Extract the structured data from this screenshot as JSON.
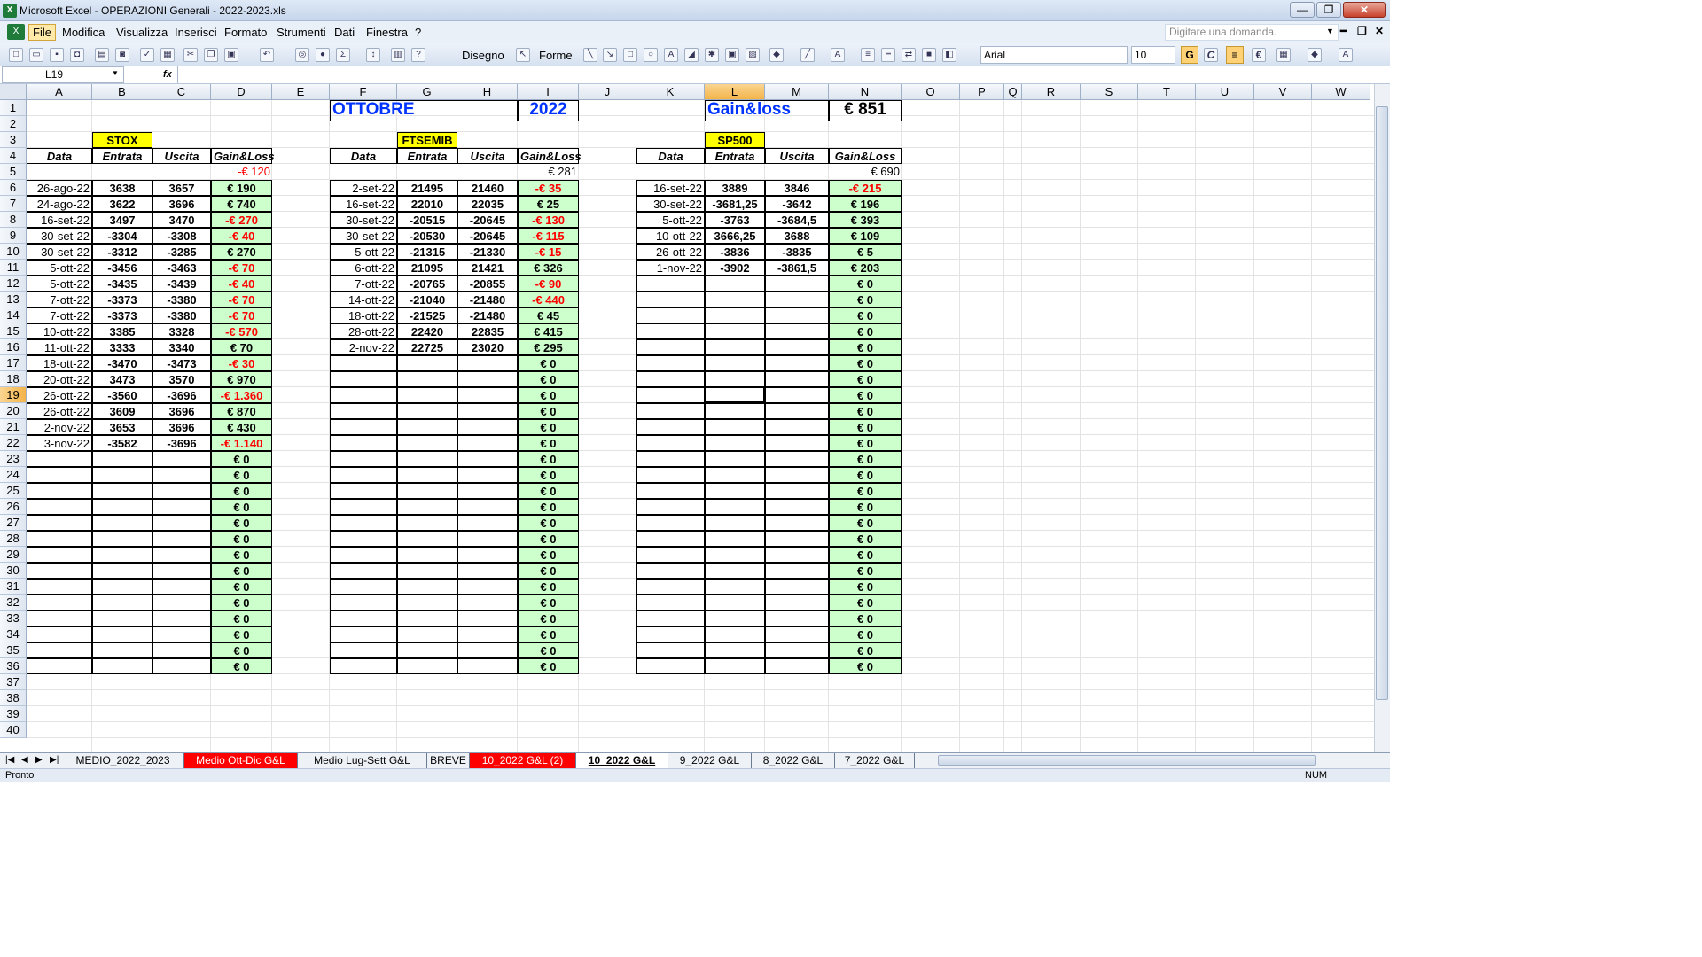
{
  "window": {
    "title": "Microsoft Excel - OPERAZIONI Generali - 2022-2023.xls",
    "min": "—",
    "max": "❐",
    "close": "✕"
  },
  "menu": {
    "items": [
      "File",
      "Modifica",
      "Visualizza",
      "Inserisci",
      "Formato",
      "Strumenti",
      "Dati",
      "Finestra",
      "?"
    ],
    "help_placeholder": "Digitare una domanda.",
    "mdi_min": "━",
    "mdi_restore": "❐",
    "mdi_close": "✕"
  },
  "toolbar": {
    "draw_label": "Disegno",
    "shapes_label": "Forme",
    "font": "Arial",
    "font_size": "10",
    "bold": "G",
    "italic": "C",
    "euro": "€"
  },
  "formula": {
    "cell_ref": "L19",
    "fx": "fx",
    "content": ""
  },
  "columns": [
    "A",
    "B",
    "C",
    "D",
    "E",
    "F",
    "G",
    "H",
    "I",
    "J",
    "K",
    "L",
    "M",
    "N",
    "O",
    "P",
    "Q",
    "R",
    "S",
    "T",
    "U",
    "V",
    "W"
  ],
  "rows": [
    "1",
    "2",
    "3",
    "4",
    "5",
    "6",
    "7",
    "8",
    "9",
    "10",
    "11",
    "12",
    "13",
    "14",
    "15",
    "16",
    "17",
    "18",
    "19",
    "20",
    "21",
    "22",
    "23",
    "24",
    "25",
    "26",
    "27",
    "28",
    "29",
    "30",
    "31",
    "32",
    "33",
    "34",
    "35",
    "36",
    "37",
    "38",
    "39",
    "40"
  ],
  "selected_col": "L",
  "selected_row": "19",
  "header": {
    "month": "OTTOBRE",
    "year": "2022",
    "gl_label": "Gain&loss",
    "gl_total": "€ 851"
  },
  "headings": {
    "date": "Data",
    "entry": "Entrata",
    "exit": "Uscita",
    "gl": "Gain&Loss"
  },
  "stox": {
    "label": "STOX",
    "subtotal": "-€ 120",
    "rows": [
      {
        "d": "26-ago-22",
        "e": "3638",
        "u": "3657",
        "g": "€ 190"
      },
      {
        "d": "24-ago-22",
        "e": "3622",
        "u": "3696",
        "g": "€ 740"
      },
      {
        "d": "16-set-22",
        "e": "3497",
        "u": "3470",
        "g": "-€ 270"
      },
      {
        "d": "30-set-22",
        "e": "-3304",
        "u": "-3308",
        "g": "-€ 40"
      },
      {
        "d": "30-set-22",
        "e": "-3312",
        "u": "-3285",
        "g": "€ 270"
      },
      {
        "d": "5-ott-22",
        "e": "-3456",
        "u": "-3463",
        "g": "-€ 70"
      },
      {
        "d": "5-ott-22",
        "e": "-3435",
        "u": "-3439",
        "g": "-€ 40"
      },
      {
        "d": "7-ott-22",
        "e": "-3373",
        "u": "-3380",
        "g": "-€ 70"
      },
      {
        "d": "7-ott-22",
        "e": "-3373",
        "u": "-3380",
        "g": "-€ 70"
      },
      {
        "d": "10-ott-22",
        "e": "3385",
        "u": "3328",
        "g": "-€ 570"
      },
      {
        "d": "11-ott-22",
        "e": "3333",
        "u": "3340",
        "g": "€ 70"
      },
      {
        "d": "18-ott-22",
        "e": "-3470",
        "u": "-3473",
        "g": "-€ 30"
      },
      {
        "d": "20-ott-22",
        "e": "3473",
        "u": "3570",
        "g": "€ 970"
      },
      {
        "d": "26-ott-22",
        "e": "-3560",
        "u": "-3696",
        "g": "-€ 1.360"
      },
      {
        "d": "26-ott-22",
        "e": "3609",
        "u": "3696",
        "g": "€ 870"
      },
      {
        "d": "2-nov-22",
        "e": "3653",
        "u": "3696",
        "g": "€ 430"
      },
      {
        "d": "3-nov-22",
        "e": "-3582",
        "u": "-3696",
        "g": "-€ 1.140"
      }
    ]
  },
  "ftsemib": {
    "label": "FTSEMIB",
    "subtotal": "€ 281",
    "rows": [
      {
        "d": "2-set-22",
        "e": "21495",
        "u": "21460",
        "g": "-€ 35"
      },
      {
        "d": "16-set-22",
        "e": "22010",
        "u": "22035",
        "g": "€ 25"
      },
      {
        "d": "30-set-22",
        "e": "-20515",
        "u": "-20645",
        "g": "-€ 130"
      },
      {
        "d": "30-set-22",
        "e": "-20530",
        "u": "-20645",
        "g": "-€ 115"
      },
      {
        "d": "5-ott-22",
        "e": "-21315",
        "u": "-21330",
        "g": "-€ 15"
      },
      {
        "d": "6-ott-22",
        "e": "21095",
        "u": "21421",
        "g": "€ 326"
      },
      {
        "d": "7-ott-22",
        "e": "-20765",
        "u": "-20855",
        "g": "-€ 90"
      },
      {
        "d": "14-ott-22",
        "e": "-21040",
        "u": "-21480",
        "g": "-€ 440"
      },
      {
        "d": "18-ott-22",
        "e": "-21525",
        "u": "-21480",
        "g": "€ 45"
      },
      {
        "d": "28-ott-22",
        "e": "22420",
        "u": "22835",
        "g": "€ 415"
      },
      {
        "d": "2-nov-22",
        "e": "22725",
        "u": "23020",
        "g": "€ 295"
      }
    ]
  },
  "sp500": {
    "label": "SP500",
    "subtotal": "€ 690",
    "rows": [
      {
        "d": "16-set-22",
        "e": "3889",
        "u": "3846",
        "g": "-€ 215"
      },
      {
        "d": "30-set-22",
        "e": "-3681,25",
        "u": "-3642",
        "g": "€ 196"
      },
      {
        "d": "5-ott-22",
        "e": "-3763",
        "u": "-3684,5",
        "g": "€ 393"
      },
      {
        "d": "10-ott-22",
        "e": "3666,25",
        "u": "3688",
        "g": "€ 109"
      },
      {
        "d": "26-ott-22",
        "e": "-3836",
        "u": "-3835",
        "g": "€ 5"
      },
      {
        "d": "1-nov-22",
        "e": "-3902",
        "u": "-3861,5",
        "g": "€ 203"
      }
    ]
  },
  "zero": "€ 0",
  "tabs": [
    {
      "label": "MEDIO_2022_2023",
      "style": "normal"
    },
    {
      "label": "Medio Ott-Dic G&L",
      "style": "red"
    },
    {
      "label": "Medio Lug-Sett G&L",
      "style": "normal"
    },
    {
      "label": "BREVE",
      "style": "normal"
    },
    {
      "label": "10_2022 G&L  (2)",
      "style": "red"
    },
    {
      "label": "10_2022 G&L",
      "style": "active"
    },
    {
      "label": "9_2022 G&L",
      "style": "normal"
    },
    {
      "label": "8_2022 G&L",
      "style": "normal"
    },
    {
      "label": "7_2022 G&L",
      "style": "normal"
    }
  ],
  "status": {
    "left": "Pronto",
    "num": "NUM"
  }
}
